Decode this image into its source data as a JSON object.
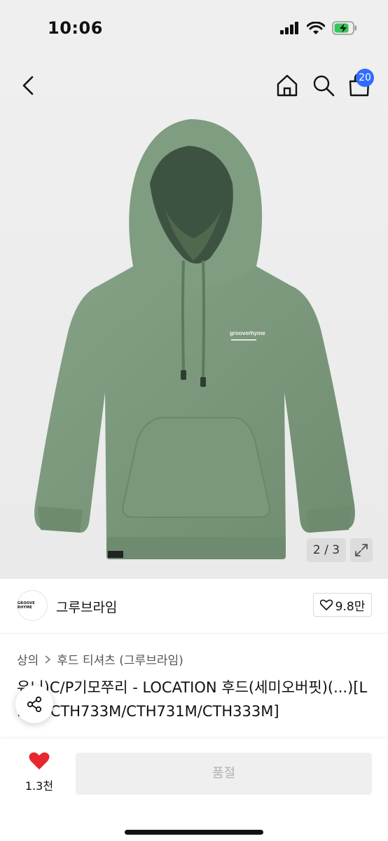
{
  "status": {
    "time": "10:06"
  },
  "nav": {
    "cart_count": "20"
  },
  "gallery": {
    "counter": "2 / 3",
    "product_logo_text": "grooverhyme"
  },
  "brand": {
    "logo_text": "GROOVE RHYME",
    "name": "그루브라임",
    "likes": "9.8만"
  },
  "breadcrumb": {
    "items": [
      "상의",
      "후드 티셔츠 (그루브라임)"
    ]
  },
  "product": {
    "title": "유니)C/P기모쭈리 - LOCATION 후드(세미오버핏)(...)[LRAWCTH733M/CTH731M/CTH333M]"
  },
  "actions": {
    "wish_count": "1.3천",
    "soldout_label": "품절"
  },
  "colors": {
    "accent": "#2f6dff",
    "heart": "#e8262f",
    "hoodie": "#7d9b7d"
  }
}
